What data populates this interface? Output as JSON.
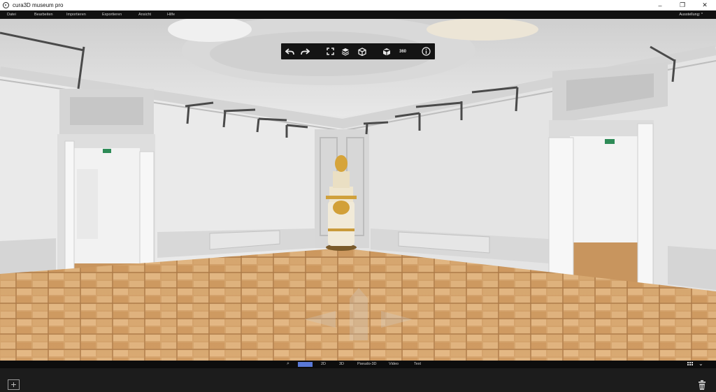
{
  "window": {
    "title": "cura3D museum pro",
    "controls": {
      "minimize": "–",
      "maximize": "❐",
      "close": "✕"
    }
  },
  "menu": {
    "items": [
      "Datei",
      "Bearbeiten",
      "Importieren",
      "Exportieren",
      "Ansicht",
      "Hilfe"
    ],
    "exhibition_label": "Ausstellung: *"
  },
  "toolbar": {
    "icons": [
      "undo-icon",
      "redo-icon",
      "fullscreen-icon",
      "layers-icon",
      "cube-icon",
      "object-icon",
      "view-360-icon",
      "info-icon"
    ],
    "label_360": "360"
  },
  "modebar": {
    "modes": [
      "Pano",
      "2D",
      "3D",
      "Pseudo-3D",
      "Video",
      "Text"
    ],
    "active_mode": "Pano"
  },
  "colors": {
    "active_mode_bg": "#5a79d6",
    "background_dark": "#1c1c1c"
  }
}
